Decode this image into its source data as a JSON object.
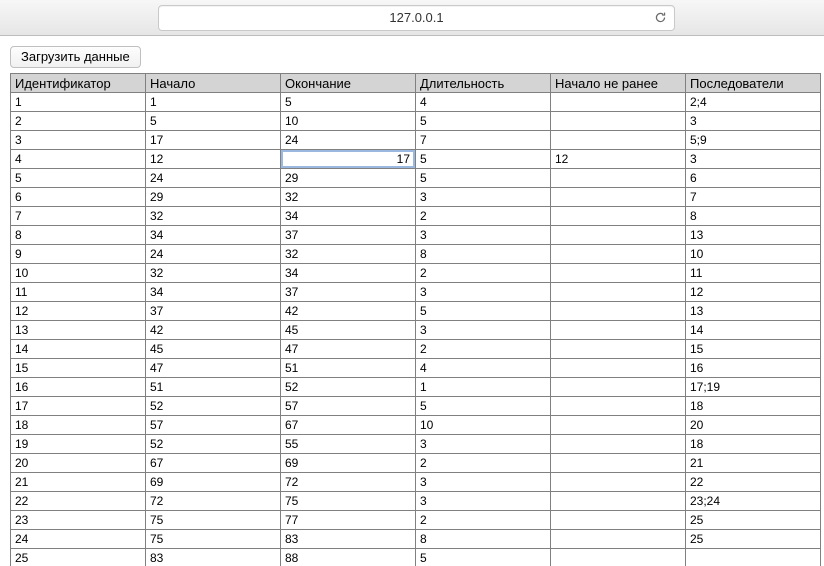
{
  "browser": {
    "address": "127.0.0.1"
  },
  "actions": {
    "load_button": "Загрузить данные"
  },
  "table": {
    "headers": {
      "id": "Идентификатор",
      "begin": "Начало",
      "end": "Окончание",
      "duration": "Длительность",
      "earliest_start": "Начало не ранее",
      "followers": "Последователи"
    },
    "editing": {
      "row": 3,
      "col": "end",
      "value": "17"
    },
    "rows": [
      {
        "id": "1",
        "begin": "1",
        "end": "5",
        "duration": "4",
        "earliest_start": "",
        "followers": "2;4"
      },
      {
        "id": "2",
        "begin": "5",
        "end": "10",
        "duration": "5",
        "earliest_start": "",
        "followers": "3"
      },
      {
        "id": "3",
        "begin": "17",
        "end": "24",
        "duration": "7",
        "earliest_start": "",
        "followers": "5;9"
      },
      {
        "id": "4",
        "begin": "12",
        "end": "17",
        "duration": "5",
        "earliest_start": "12",
        "followers": "3"
      },
      {
        "id": "5",
        "begin": "24",
        "end": "29",
        "duration": "5",
        "earliest_start": "",
        "followers": "6"
      },
      {
        "id": "6",
        "begin": "29",
        "end": "32",
        "duration": "3",
        "earliest_start": "",
        "followers": "7"
      },
      {
        "id": "7",
        "begin": "32",
        "end": "34",
        "duration": "2",
        "earliest_start": "",
        "followers": "8"
      },
      {
        "id": "8",
        "begin": "34",
        "end": "37",
        "duration": "3",
        "earliest_start": "",
        "followers": "13"
      },
      {
        "id": "9",
        "begin": "24",
        "end": "32",
        "duration": "8",
        "earliest_start": "",
        "followers": "10"
      },
      {
        "id": "10",
        "begin": "32",
        "end": "34",
        "duration": "2",
        "earliest_start": "",
        "followers": "11"
      },
      {
        "id": "11",
        "begin": "34",
        "end": "37",
        "duration": "3",
        "earliest_start": "",
        "followers": "12"
      },
      {
        "id": "12",
        "begin": "37",
        "end": "42",
        "duration": "5",
        "earliest_start": "",
        "followers": "13"
      },
      {
        "id": "13",
        "begin": "42",
        "end": "45",
        "duration": "3",
        "earliest_start": "",
        "followers": "14"
      },
      {
        "id": "14",
        "begin": "45",
        "end": "47",
        "duration": "2",
        "earliest_start": "",
        "followers": "15"
      },
      {
        "id": "15",
        "begin": "47",
        "end": "51",
        "duration": "4",
        "earliest_start": "",
        "followers": "16"
      },
      {
        "id": "16",
        "begin": "51",
        "end": "52",
        "duration": "1",
        "earliest_start": "",
        "followers": "17;19"
      },
      {
        "id": "17",
        "begin": "52",
        "end": "57",
        "duration": "5",
        "earliest_start": "",
        "followers": "18"
      },
      {
        "id": "18",
        "begin": "57",
        "end": "67",
        "duration": "10",
        "earliest_start": "",
        "followers": "20"
      },
      {
        "id": "19",
        "begin": "52",
        "end": "55",
        "duration": "3",
        "earliest_start": "",
        "followers": "18"
      },
      {
        "id": "20",
        "begin": "67",
        "end": "69",
        "duration": "2",
        "earliest_start": "",
        "followers": "21"
      },
      {
        "id": "21",
        "begin": "69",
        "end": "72",
        "duration": "3",
        "earliest_start": "",
        "followers": "22"
      },
      {
        "id": "22",
        "begin": "72",
        "end": "75",
        "duration": "3",
        "earliest_start": "",
        "followers": "23;24"
      },
      {
        "id": "23",
        "begin": "75",
        "end": "77",
        "duration": "2",
        "earliest_start": "",
        "followers": "25"
      },
      {
        "id": "24",
        "begin": "75",
        "end": "83",
        "duration": "8",
        "earliest_start": "",
        "followers": "25"
      },
      {
        "id": "25",
        "begin": "83",
        "end": "88",
        "duration": "5",
        "earliest_start": "",
        "followers": ""
      }
    ]
  }
}
